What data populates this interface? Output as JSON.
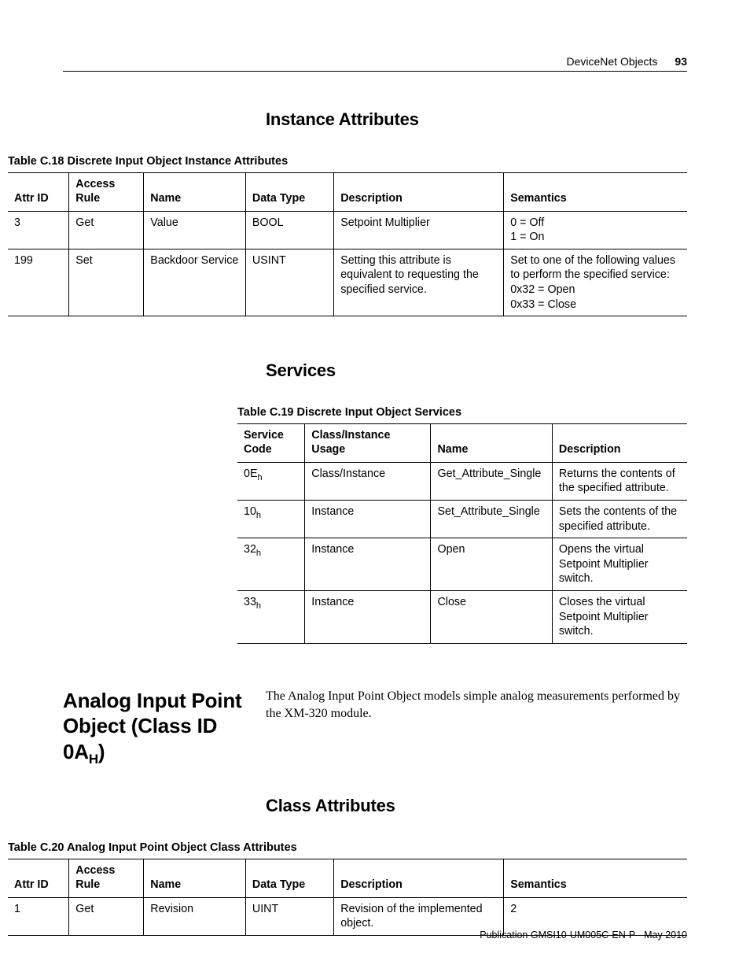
{
  "header": {
    "title": "DeviceNet Objects",
    "page_number": "93"
  },
  "section1": {
    "heading": "Instance Attributes",
    "table_caption": "Table C.18 Discrete Input Object Instance Attributes",
    "headers": [
      "Attr ID",
      "Access Rule",
      "Name",
      "Data Type",
      "Description",
      "Semantics"
    ],
    "rows": [
      {
        "attr_id": "3",
        "access": "Get",
        "name": "Value",
        "dtype": "BOOL",
        "desc": "Setpoint Multiplier",
        "sem": "0 = Off\n1 = On"
      },
      {
        "attr_id": "199",
        "access": "Set",
        "name": "Backdoor Service",
        "dtype": "USINT",
        "desc": "Setting this attribute is equivalent to requesting the specified service.",
        "sem": "Set to one of the following values to perform the specified service:\n0x32 = Open\n0x33 = Close"
      }
    ]
  },
  "section2": {
    "heading": "Services",
    "table_caption": "Table C.19 Discrete Input Object Services",
    "headers": [
      "Service Code",
      "Class/Instance Usage",
      "Name",
      "Description"
    ],
    "rows": [
      {
        "code": "0E",
        "codesub": "h",
        "usage": "Class/Instance",
        "name": "Get_Attribute_Single",
        "desc": "Returns the contents of the specified attribute."
      },
      {
        "code": "10",
        "codesub": "h",
        "usage": "Instance",
        "name": "Set_Attribute_Single",
        "desc": "Sets the contents of the specified attribute."
      },
      {
        "code": "32",
        "codesub": "h",
        "usage": "Instance",
        "name": "Open",
        "desc": "Opens the virtual Setpoint Multiplier switch."
      },
      {
        "code": "33",
        "codesub": "h",
        "usage": "Instance",
        "name": "Close",
        "desc": "Closes the virtual Setpoint Multiplier switch."
      }
    ]
  },
  "section3": {
    "main_heading_pre": "Analog Input Point Object (Class ID 0A",
    "main_heading_sub": "H",
    "main_heading_post": ")",
    "body": "The Analog Input Point Object models simple analog measurements performed by the XM-320 module.",
    "sub_heading": "Class Attributes",
    "table_caption": "Table C.20 Analog Input Point Object Class Attributes",
    "headers": [
      "Attr ID",
      "Access Rule",
      "Name",
      "Data Type",
      "Description",
      "Semantics"
    ],
    "rows": [
      {
        "attr_id": "1",
        "access": "Get",
        "name": "Revision",
        "dtype": "UINT",
        "desc": "Revision of the implemented object.",
        "sem": "2"
      }
    ]
  },
  "footer": "Publication GMSI10-UM005C-EN-P - May 2010"
}
